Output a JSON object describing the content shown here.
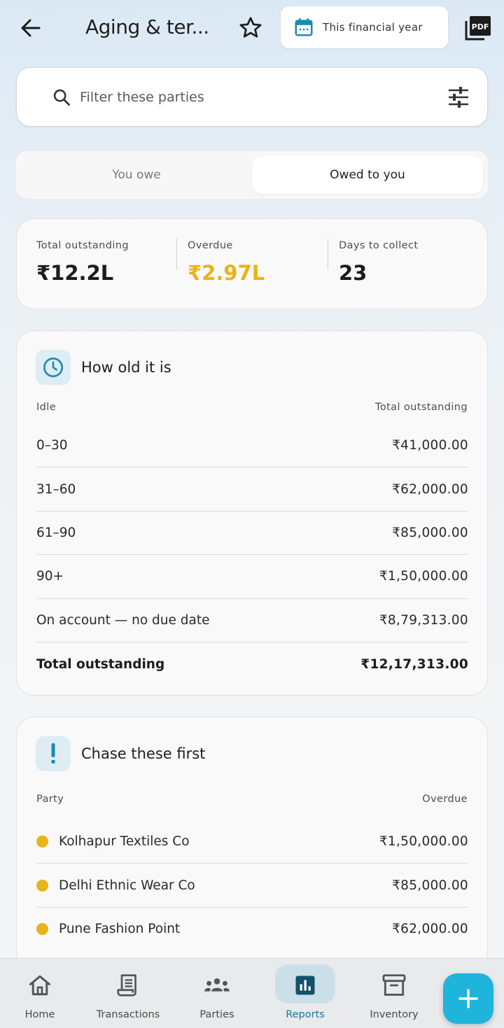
{
  "header": {
    "title": "Aging & ter...",
    "period_label": "This financial year"
  },
  "search": {
    "placeholder": "Filter these parties"
  },
  "toggle": {
    "left_label": "You owe",
    "right_label": "Owed to you",
    "selected": "right"
  },
  "summary": {
    "total_outstanding_label": "Total outstanding",
    "total_outstanding_value": "₹12.2L",
    "overdue_label": "Overdue",
    "overdue_value": "₹2.97L",
    "days_label": "Days to collect",
    "days_value": "23"
  },
  "aging": {
    "title": "How old it is",
    "col_left": "Idle",
    "col_right": "Total outstanding",
    "rows": [
      {
        "label": "0–30",
        "amount": "₹41,000.00"
      },
      {
        "label": "31–60",
        "amount": "₹62,000.00"
      },
      {
        "label": "61–90",
        "amount": "₹85,000.00"
      },
      {
        "label": "90+",
        "amount": "₹1,50,000.00"
      },
      {
        "label": "On account — no due date",
        "amount": "₹8,79,313.00"
      }
    ],
    "total_label": "Total outstanding",
    "total_amount": "₹12,17,313.00"
  },
  "chase": {
    "title": "Chase these first",
    "col_left": "Party",
    "col_right": "Overdue",
    "rows": [
      {
        "party": "Kolhapur Textiles Co",
        "amount": "₹1,50,000.00"
      },
      {
        "party": "Delhi Ethnic Wear Co",
        "amount": "₹85,000.00"
      },
      {
        "party": "Pune Fashion Point",
        "amount": "₹62,000.00"
      }
    ]
  },
  "nav": {
    "items": [
      {
        "label": "Home",
        "icon": "home-icon"
      },
      {
        "label": "Transactions",
        "icon": "receipt-icon"
      },
      {
        "label": "Parties",
        "icon": "people-icon"
      },
      {
        "label": "Reports",
        "icon": "bar-chart-icon"
      },
      {
        "label": "Inventory",
        "icon": "archive-icon"
      }
    ],
    "active": "Reports"
  },
  "colors": {
    "accent": "#1a78a0",
    "overdue": "#e8b419",
    "fab": "#1eb4dc"
  }
}
